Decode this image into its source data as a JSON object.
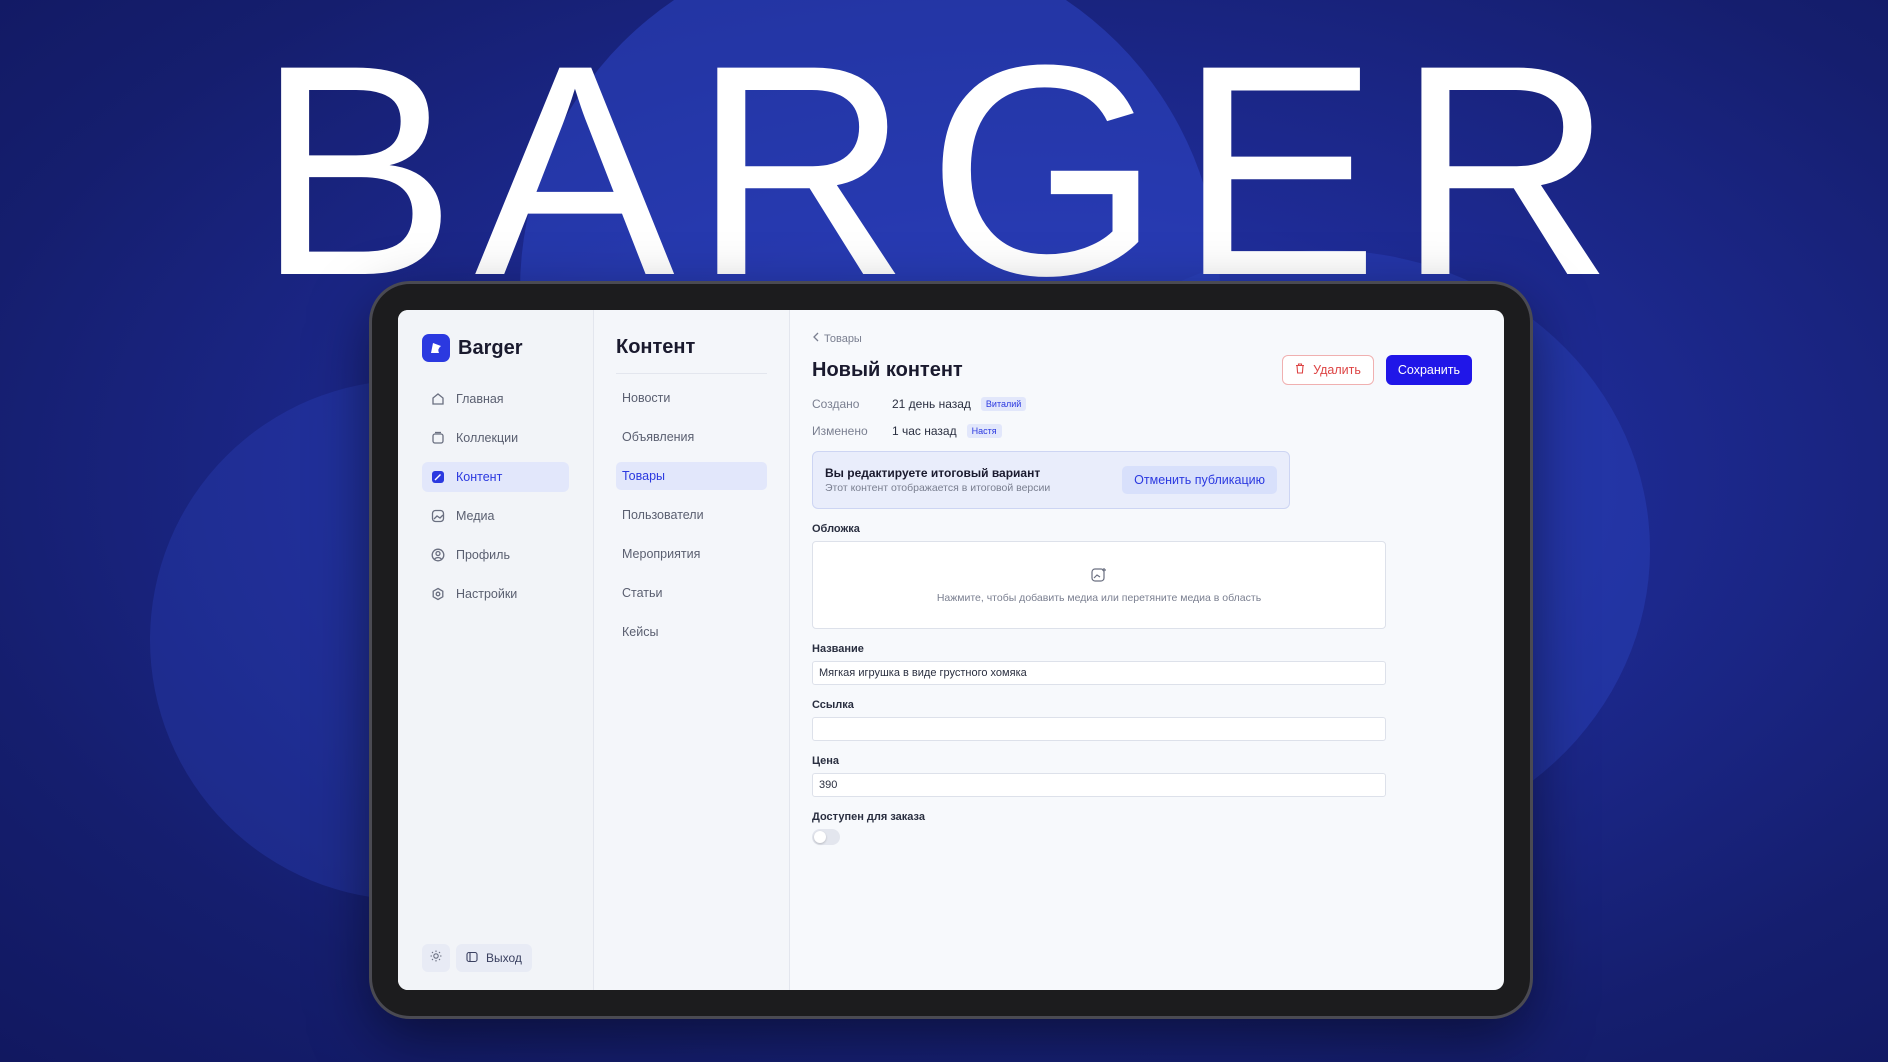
{
  "hero": {
    "title": "BARGER"
  },
  "app": {
    "logo_text": "Barger"
  },
  "sidebar": {
    "items": [
      {
        "label": "Главная",
        "icon": "home-icon"
      },
      {
        "label": "Коллекции",
        "icon": "collection-icon"
      },
      {
        "label": "Контент",
        "icon": "edit-icon",
        "active": true
      },
      {
        "label": "Медиа",
        "icon": "image-icon"
      },
      {
        "label": "Профиль",
        "icon": "user-icon"
      },
      {
        "label": "Настройки",
        "icon": "gear-icon"
      }
    ],
    "logout_label": "Выход"
  },
  "content_nav": {
    "title": "Контент",
    "items": [
      "Новости",
      "Объявления",
      "Товары",
      "Пользователи",
      "Мероприятия",
      "Статьи",
      "Кейсы"
    ],
    "active_index": 2
  },
  "main": {
    "breadcrumb": "Товары",
    "title": "Новый контент",
    "delete_label": "Удалить",
    "save_label": "Сохранить",
    "meta": [
      {
        "label": "Создано",
        "value": "21 день назад",
        "badge": "Виталий"
      },
      {
        "label": "Изменено",
        "value": "1 час назад",
        "badge": "Настя"
      }
    ],
    "notice": {
      "title": "Вы редактируете итоговый вариант",
      "subtitle": "Этот контент отображается в итоговой версии",
      "button": "Отменить публикацию"
    },
    "cover": {
      "label": "Обложка",
      "hint": "Нажмите, чтобы добавить медиа или перетяните медиа в область"
    },
    "fields": {
      "name_label": "Название",
      "name_value": "Мягкая игрушка в виде грустного хомяка",
      "link_label": "Ссылка",
      "link_value": "",
      "price_label": "Цена",
      "price_value": "390",
      "available_label": "Доступен для заказа",
      "available": false
    }
  },
  "colors": {
    "accent": "#2b39e0",
    "save": "#2016e8",
    "background": "#1b2580"
  }
}
